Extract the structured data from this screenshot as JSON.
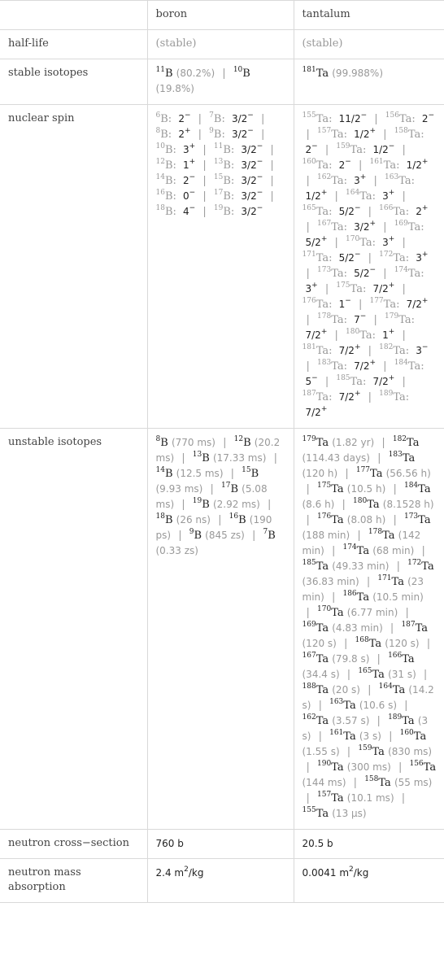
{
  "header": {
    "corner": "",
    "columns": [
      "boron",
      "tantalum"
    ]
  },
  "rows": {
    "half_life": {
      "label": "half-life",
      "boron": "(stable)",
      "tantalum": "(stable)"
    },
    "stable_isotopes": {
      "label": "stable isotopes",
      "boron": [
        {
          "mass": "11",
          "symbol": "B",
          "abundance": "(80.2%)"
        },
        {
          "mass": "10",
          "symbol": "B",
          "abundance": "(19.8%)"
        }
      ],
      "tantalum": [
        {
          "mass": "181",
          "symbol": "Ta",
          "abundance": "(99.988%)"
        }
      ]
    },
    "nuclear_spin": {
      "label": "nuclear spin",
      "boron": [
        {
          "mass": "6",
          "symbol": "B",
          "spin": "2",
          "parity": "−"
        },
        {
          "mass": "7",
          "symbol": "B",
          "spin": "3/2",
          "parity": "−"
        },
        {
          "mass": "8",
          "symbol": "B",
          "spin": "2",
          "parity": "+"
        },
        {
          "mass": "9",
          "symbol": "B",
          "spin": "3/2",
          "parity": "−"
        },
        {
          "mass": "10",
          "symbol": "B",
          "spin": "3",
          "parity": "+"
        },
        {
          "mass": "11",
          "symbol": "B",
          "spin": "3/2",
          "parity": "−"
        },
        {
          "mass": "12",
          "symbol": "B",
          "spin": "1",
          "parity": "+"
        },
        {
          "mass": "13",
          "symbol": "B",
          "spin": "3/2",
          "parity": "−"
        },
        {
          "mass": "14",
          "symbol": "B",
          "spin": "2",
          "parity": "−"
        },
        {
          "mass": "15",
          "symbol": "B",
          "spin": "3/2",
          "parity": "−"
        },
        {
          "mass": "16",
          "symbol": "B",
          "spin": "0",
          "parity": "−"
        },
        {
          "mass": "17",
          "symbol": "B",
          "spin": "3/2",
          "parity": "−"
        },
        {
          "mass": "18",
          "symbol": "B",
          "spin": "4",
          "parity": "−"
        },
        {
          "mass": "19",
          "symbol": "B",
          "spin": "3/2",
          "parity": "−"
        }
      ],
      "tantalum": [
        {
          "mass": "155",
          "symbol": "Ta",
          "spin": "11/2",
          "parity": "−"
        },
        {
          "mass": "156",
          "symbol": "Ta",
          "spin": "2",
          "parity": "−"
        },
        {
          "mass": "157",
          "symbol": "Ta",
          "spin": "1/2",
          "parity": "+"
        },
        {
          "mass": "158",
          "symbol": "Ta",
          "spin": "2",
          "parity": "−"
        },
        {
          "mass": "159",
          "symbol": "Ta",
          "spin": "1/2",
          "parity": "−"
        },
        {
          "mass": "160",
          "symbol": "Ta",
          "spin": "2",
          "parity": "−"
        },
        {
          "mass": "161",
          "symbol": "Ta",
          "spin": "1/2",
          "parity": "+"
        },
        {
          "mass": "162",
          "symbol": "Ta",
          "spin": "3",
          "parity": "+"
        },
        {
          "mass": "163",
          "symbol": "Ta",
          "spin": "1/2",
          "parity": "+"
        },
        {
          "mass": "164",
          "symbol": "Ta",
          "spin": "3",
          "parity": "+"
        },
        {
          "mass": "165",
          "symbol": "Ta",
          "spin": "5/2",
          "parity": "−"
        },
        {
          "mass": "166",
          "symbol": "Ta",
          "spin": "2",
          "parity": "+"
        },
        {
          "mass": "167",
          "symbol": "Ta",
          "spin": "3/2",
          "parity": "+"
        },
        {
          "mass": "169",
          "symbol": "Ta",
          "spin": "5/2",
          "parity": "+"
        },
        {
          "mass": "170",
          "symbol": "Ta",
          "spin": "3",
          "parity": "+"
        },
        {
          "mass": "171",
          "symbol": "Ta",
          "spin": "5/2",
          "parity": "−"
        },
        {
          "mass": "172",
          "symbol": "Ta",
          "spin": "3",
          "parity": "+"
        },
        {
          "mass": "173",
          "symbol": "Ta",
          "spin": "5/2",
          "parity": "−"
        },
        {
          "mass": "174",
          "symbol": "Ta",
          "spin": "3",
          "parity": "+"
        },
        {
          "mass": "175",
          "symbol": "Ta",
          "spin": "7/2",
          "parity": "+"
        },
        {
          "mass": "176",
          "symbol": "Ta",
          "spin": "1",
          "parity": "−"
        },
        {
          "mass": "177",
          "symbol": "Ta",
          "spin": "7/2",
          "parity": "+"
        },
        {
          "mass": "178",
          "symbol": "Ta",
          "spin": "7",
          "parity": "−"
        },
        {
          "mass": "179",
          "symbol": "Ta",
          "spin": "7/2",
          "parity": "+"
        },
        {
          "mass": "180",
          "symbol": "Ta",
          "spin": "1",
          "parity": "+"
        },
        {
          "mass": "181",
          "symbol": "Ta",
          "spin": "7/2",
          "parity": "+"
        },
        {
          "mass": "182",
          "symbol": "Ta",
          "spin": "3",
          "parity": "−"
        },
        {
          "mass": "183",
          "symbol": "Ta",
          "spin": "7/2",
          "parity": "+"
        },
        {
          "mass": "184",
          "symbol": "Ta",
          "spin": "5",
          "parity": "−"
        },
        {
          "mass": "185",
          "symbol": "Ta",
          "spin": "7/2",
          "parity": "+"
        },
        {
          "mass": "187",
          "symbol": "Ta",
          "spin": "7/2",
          "parity": "+"
        },
        {
          "mass": "189",
          "symbol": "Ta",
          "spin": "7/2",
          "parity": "+"
        }
      ]
    },
    "unstable_isotopes": {
      "label": "unstable isotopes",
      "boron": [
        {
          "mass": "8",
          "symbol": "B",
          "half_life": "(770 ms)"
        },
        {
          "mass": "12",
          "symbol": "B",
          "half_life": "(20.2 ms)"
        },
        {
          "mass": "13",
          "symbol": "B",
          "half_life": "(17.33 ms)"
        },
        {
          "mass": "14",
          "symbol": "B",
          "half_life": "(12.5 ms)"
        },
        {
          "mass": "15",
          "symbol": "B",
          "half_life": "(9.93 ms)"
        },
        {
          "mass": "17",
          "symbol": "B",
          "half_life": "(5.08 ms)"
        },
        {
          "mass": "19",
          "symbol": "B",
          "half_life": "(2.92 ms)"
        },
        {
          "mass": "18",
          "symbol": "B",
          "half_life": "(26 ns)"
        },
        {
          "mass": "16",
          "symbol": "B",
          "half_life": "(190 ps)"
        },
        {
          "mass": "9",
          "symbol": "B",
          "half_life": "(845 zs)"
        },
        {
          "mass": "7",
          "symbol": "B",
          "half_life": "(0.33 zs)"
        }
      ],
      "tantalum": [
        {
          "mass": "179",
          "symbol": "Ta",
          "half_life": "(1.82 yr)"
        },
        {
          "mass": "182",
          "symbol": "Ta",
          "half_life": "(114.43 days)"
        },
        {
          "mass": "183",
          "symbol": "Ta",
          "half_life": "(120 h)"
        },
        {
          "mass": "177",
          "symbol": "Ta",
          "half_life": "(56.56 h)"
        },
        {
          "mass": "175",
          "symbol": "Ta",
          "half_life": "(10.5 h)"
        },
        {
          "mass": "184",
          "symbol": "Ta",
          "half_life": "(8.6 h)"
        },
        {
          "mass": "180",
          "symbol": "Ta",
          "half_life": "(8.1528 h)"
        },
        {
          "mass": "176",
          "symbol": "Ta",
          "half_life": "(8.08 h)"
        },
        {
          "mass": "173",
          "symbol": "Ta",
          "half_life": "(188 min)"
        },
        {
          "mass": "178",
          "symbol": "Ta",
          "half_life": "(142 min)"
        },
        {
          "mass": "174",
          "symbol": "Ta",
          "half_life": "(68 min)"
        },
        {
          "mass": "185",
          "symbol": "Ta",
          "half_life": "(49.33 min)"
        },
        {
          "mass": "172",
          "symbol": "Ta",
          "half_life": "(36.83 min)"
        },
        {
          "mass": "171",
          "symbol": "Ta",
          "half_life": "(23 min)"
        },
        {
          "mass": "186",
          "symbol": "Ta",
          "half_life": "(10.5 min)"
        },
        {
          "mass": "170",
          "symbol": "Ta",
          "half_life": "(6.77 min)"
        },
        {
          "mass": "169",
          "symbol": "Ta",
          "half_life": "(4.83 min)"
        },
        {
          "mass": "187",
          "symbol": "Ta",
          "half_life": "(120 s)"
        },
        {
          "mass": "168",
          "symbol": "Ta",
          "half_life": "(120 s)"
        },
        {
          "mass": "167",
          "symbol": "Ta",
          "half_life": "(79.8 s)"
        },
        {
          "mass": "166",
          "symbol": "Ta",
          "half_life": "(34.4 s)"
        },
        {
          "mass": "165",
          "symbol": "Ta",
          "half_life": "(31 s)"
        },
        {
          "mass": "188",
          "symbol": "Ta",
          "half_life": "(20 s)"
        },
        {
          "mass": "164",
          "symbol": "Ta",
          "half_life": "(14.2 s)"
        },
        {
          "mass": "163",
          "symbol": "Ta",
          "half_life": "(10.6 s)"
        },
        {
          "mass": "162",
          "symbol": "Ta",
          "half_life": "(3.57 s)"
        },
        {
          "mass": "189",
          "symbol": "Ta",
          "half_life": "(3 s)"
        },
        {
          "mass": "161",
          "symbol": "Ta",
          "half_life": "(3 s)"
        },
        {
          "mass": "160",
          "symbol": "Ta",
          "half_life": "(1.55 s)"
        },
        {
          "mass": "159",
          "symbol": "Ta",
          "half_life": "(830 ms)"
        },
        {
          "mass": "190",
          "symbol": "Ta",
          "half_life": "(300 ms)"
        },
        {
          "mass": "156",
          "symbol": "Ta",
          "half_life": "(144 ms)"
        },
        {
          "mass": "158",
          "symbol": "Ta",
          "half_life": "(55 ms)"
        },
        {
          "mass": "157",
          "symbol": "Ta",
          "half_life": "(10.1 ms)"
        },
        {
          "mass": "155",
          "symbol": "Ta",
          "half_life": "(13 μs)"
        }
      ]
    },
    "neutron_cross_section": {
      "label": "neutron cross−section",
      "boron": "760 b",
      "tantalum": "20.5 b"
    },
    "neutron_mass_absorption": {
      "label": "neutron mass absorption",
      "boron": {
        "value": "2.4",
        "unit_base": "m",
        "unit_exp": "2",
        "unit_rest": "/kg"
      },
      "tantalum": {
        "value": "0.0041",
        "unit_base": "m",
        "unit_exp": "2",
        "unit_rest": "/kg"
      }
    }
  },
  "separator": "|"
}
